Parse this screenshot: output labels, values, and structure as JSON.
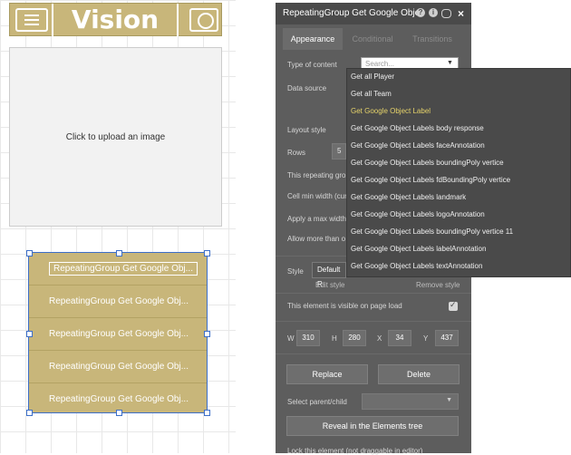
{
  "header": {
    "title": "Vision"
  },
  "upload": {
    "text": "Click to upload an image"
  },
  "repeating_group": {
    "rows": [
      "RepeatingGroup Get Google Obj...",
      "RepeatingGroup Get Google Obj...",
      "RepeatingGroup Get Google Obj...",
      "RepeatingGroup Get Google Obj...",
      "RepeatingGroup Get Google Obj..."
    ]
  },
  "panel": {
    "title": "RepeatingGroup Get Google Obje",
    "tabs": [
      "Appearance",
      "Conditional",
      "Transitions"
    ],
    "type_of_content_label": "Type of content",
    "search_placeholder": "Search...",
    "data_source_label": "Data source",
    "layout_style_label": "Layout style",
    "rows_label": "Rows",
    "rows_value": "5",
    "repeating_label": "This repeating grou",
    "cell_min_width_label": "Cell min width (cur",
    "apply_max_width_label": "Apply a max width",
    "allow_more_label": "Allow more than o",
    "style_label": "Style",
    "style_value": "Default R",
    "edit_style": "Edit style",
    "remove_style": "Remove style",
    "visible_label": "This element is visible on page load",
    "coords": {
      "w_label": "W",
      "w": "310",
      "h_label": "H",
      "h": "280",
      "x_label": "X",
      "x": "34",
      "y_label": "Y",
      "y": "437"
    },
    "replace_button": "Replace",
    "delete_button": "Delete",
    "select_parent_label": "Select parent/child",
    "reveal_button": "Reveal in the Elements tree",
    "lock_label": "Lock this element (not draggable in editor)"
  },
  "dropdown": {
    "items": [
      "Get all Player",
      "Get all Team",
      "Get Google Object Label",
      "Get Google Object Labels body response",
      "Get Google Object Labels faceAnnotation",
      "Get Google Object Labels boundingPoly vertice",
      "Get Google Object Labels fdBoundingPoly vertice",
      "Get Google Object Labels landmark",
      "Get Google Object Labels logoAnnotation",
      "Get Google Object Labels boundingPoly vertice 11",
      "Get Google Object Labels labelAnnotation",
      "Get Google Object Labels textAnnotation"
    ],
    "highlighted_index": 2,
    "highlight_color": "#e6d36a"
  }
}
